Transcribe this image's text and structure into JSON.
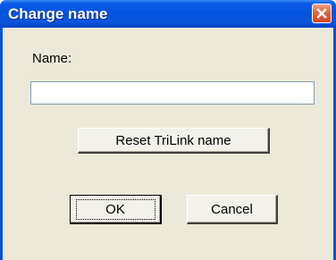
{
  "window": {
    "title": "Change name",
    "close_icon": "close-icon"
  },
  "form": {
    "name_label": "Name:",
    "name_value": "",
    "name_placeholder": ""
  },
  "buttons": {
    "reset_label": "Reset TriLink name",
    "ok_label": "OK",
    "cancel_label": "Cancel"
  },
  "colors": {
    "titlebar": "#0453e0",
    "client_bg": "#ece9d8",
    "close_button": "#d1451d"
  }
}
